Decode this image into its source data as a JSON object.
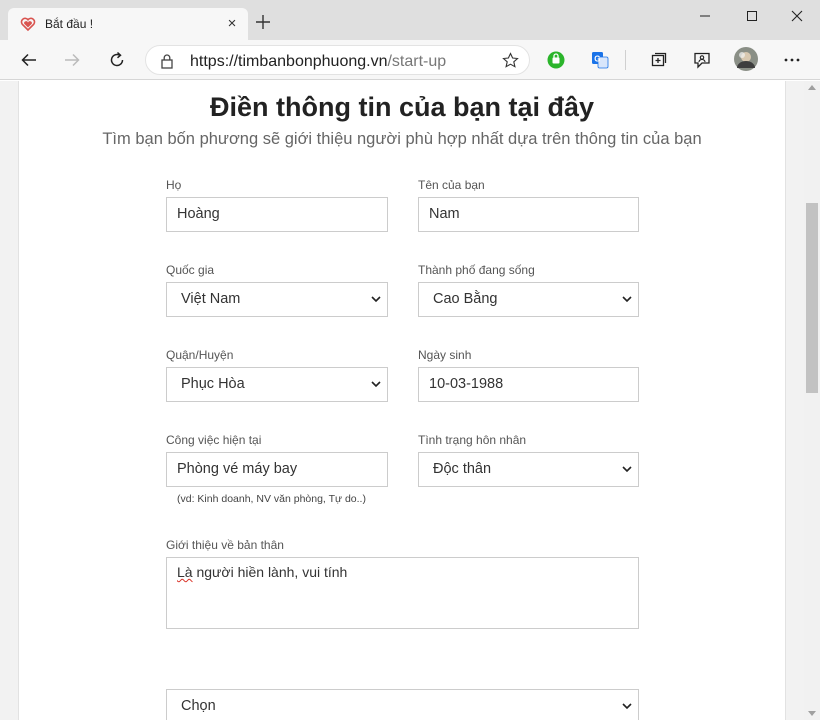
{
  "browser": {
    "tab_title": "Bắt đầu !",
    "url_host": "https://timbanbonphuong.vn",
    "url_path": "/start-up",
    "tab_close": "×"
  },
  "page": {
    "title": "Điền thông tin của bạn tại đây",
    "subtitle": "Tìm bạn bốn phương sẽ giới thiệu người phù hợp nhất dựa trên thông tin của bạn"
  },
  "form": {
    "last_name": {
      "label": "Họ",
      "value": "Hoàng"
    },
    "first_name": {
      "label": "Tên của bạn",
      "value": "Nam"
    },
    "country": {
      "label": "Quốc gia",
      "value": "Việt Nam"
    },
    "city": {
      "label": "Thành phố đang sống",
      "value": "Cao Bằng"
    },
    "district": {
      "label": "Quận/Huyện",
      "value": "Phục Hòa"
    },
    "birthday": {
      "label": "Ngày sinh",
      "value": "10-03-1988"
    },
    "job": {
      "label": "Công việc hiện tại",
      "value": "Phòng vé máy bay",
      "hint": "(vd: Kinh doanh, NV văn phòng, Tự do..)"
    },
    "marital": {
      "label": "Tình trạng hôn nhân",
      "value": "Độc thân"
    },
    "about": {
      "label": "Giới thiệu về bản thân",
      "value_first_word": "Là",
      "value_rest": " người hiền lành, vui tính"
    },
    "extra_select": {
      "value": "Chọn"
    }
  },
  "colors": {
    "favicon": "#d9534f",
    "extension_green": "#2bb52b",
    "translate_blue": "#1a73e8"
  }
}
